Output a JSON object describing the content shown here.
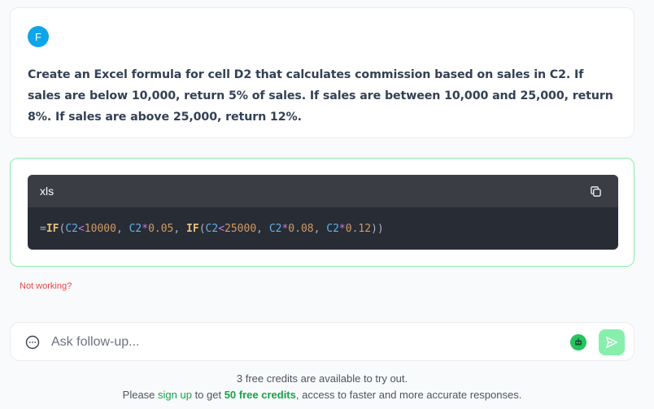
{
  "prompt": {
    "avatar_initial": "F",
    "text": "Create an Excel formula for cell D2 that calculates commission based on sales in C2. If sales are below 10,000, return 5% of sales. If sales are between 10,000 and 25,000, return 8%. If sales are above 25,000, return 12%."
  },
  "answer": {
    "language": "xls",
    "code_tokens": [
      {
        "t": "=",
        "c": "p"
      },
      {
        "t": "IF",
        "c": "fn"
      },
      {
        "t": "(",
        "c": "p"
      },
      {
        "t": "C2",
        "c": "ref"
      },
      {
        "t": "<",
        "c": "op"
      },
      {
        "t": "10000",
        "c": "num"
      },
      {
        "t": ", ",
        "c": "p"
      },
      {
        "t": "C2",
        "c": "ref"
      },
      {
        "t": "*",
        "c": "op"
      },
      {
        "t": "0.05",
        "c": "num"
      },
      {
        "t": ", ",
        "c": "p"
      },
      {
        "t": "IF",
        "c": "fn"
      },
      {
        "t": "(",
        "c": "p"
      },
      {
        "t": "C2",
        "c": "ref"
      },
      {
        "t": "<",
        "c": "op"
      },
      {
        "t": "25000",
        "c": "num"
      },
      {
        "t": ", ",
        "c": "p"
      },
      {
        "t": "C2",
        "c": "ref"
      },
      {
        "t": "*",
        "c": "op"
      },
      {
        "t": "0.08",
        "c": "num"
      },
      {
        "t": ", ",
        "c": "p"
      },
      {
        "t": "C2",
        "c": "ref"
      },
      {
        "t": "*",
        "c": "op"
      },
      {
        "t": "0.12",
        "c": "num"
      },
      {
        "t": "))",
        "c": "p"
      }
    ],
    "copy_icon": "copy-icon",
    "not_working_label": "Not working?"
  },
  "followup": {
    "placeholder": "Ask follow-up...",
    "value": "",
    "chat_icon": "chat-bubble-icon",
    "bot_icon": "robot-icon",
    "send_icon": "send-icon"
  },
  "footer": {
    "credits_text": "3 free credits are available to try out.",
    "signup_prefix": "Please ",
    "signup_link": "sign up",
    "signup_middle": " to get ",
    "signup_credits": "50 free credits",
    "signup_suffix": ", access to faster and more accurate responses."
  },
  "colors": {
    "accent": "#22c55e",
    "accent_light": "#86efac",
    "avatar": "#0ea5e9",
    "error": "#ef4444",
    "code_bg": "#282c34"
  }
}
